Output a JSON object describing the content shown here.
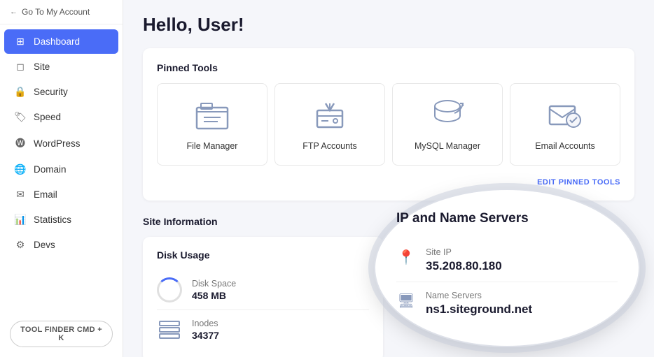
{
  "sidebar": {
    "go_to_account": "Go To My Account",
    "items": [
      {
        "id": "dashboard",
        "label": "Dashboard",
        "icon": "⊞",
        "active": true
      },
      {
        "id": "site",
        "label": "Site",
        "icon": "◻"
      },
      {
        "id": "security",
        "label": "Security",
        "icon": "🔒"
      },
      {
        "id": "speed",
        "label": "Speed",
        "icon": "🏷"
      },
      {
        "id": "wordpress",
        "label": "WordPress",
        "icon": "🅦"
      },
      {
        "id": "domain",
        "label": "Domain",
        "icon": "🌐"
      },
      {
        "id": "email",
        "label": "Email",
        "icon": "✉"
      },
      {
        "id": "statistics",
        "label": "Statistics",
        "icon": "📊"
      },
      {
        "id": "devs",
        "label": "Devs",
        "icon": "⚙"
      }
    ],
    "tool_finder_label": "TOOL FINDER CMD + K"
  },
  "main": {
    "greeting": "Hello, User!",
    "pinned_tools": {
      "section_title": "Pinned Tools",
      "edit_label": "EDIT PINNED TOOLS",
      "tools": [
        {
          "id": "file-manager",
          "label": "File Manager"
        },
        {
          "id": "ftp-accounts",
          "label": "FTP Accounts"
        },
        {
          "id": "mysql-manager",
          "label": "MySQL Manager"
        },
        {
          "id": "email-accounts",
          "label": "Email Accounts"
        }
      ]
    },
    "site_info": {
      "section_title": "Site Information",
      "disk_card": {
        "title": "Disk Usage",
        "rows": [
          {
            "label": "Disk Space",
            "value": "458 MB"
          },
          {
            "label": "Inodes",
            "value": "34377"
          }
        ]
      }
    },
    "ip_panel": {
      "title": "IP and Name Servers",
      "site_ip_label": "Site IP",
      "site_ip_value": "35.208.80.180",
      "name_servers_label": "Name Servers",
      "name_servers_value": "ns1.siteground.net"
    }
  }
}
